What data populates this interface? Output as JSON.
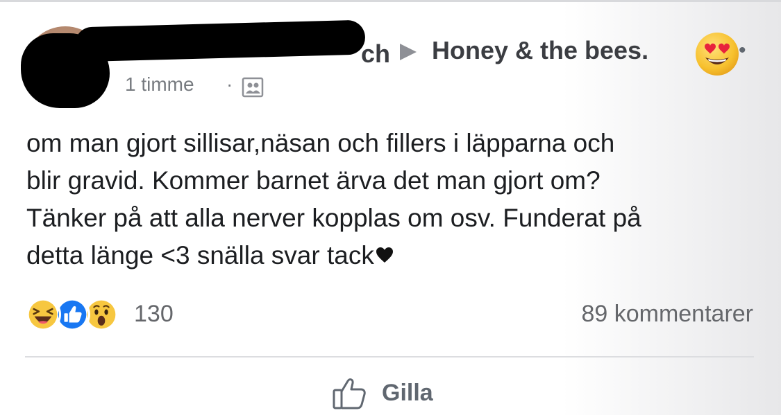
{
  "post": {
    "author_visible_tail": "ch",
    "group_name": "Honey & the bees.",
    "time": "1 timme",
    "separator": "·",
    "more_icon": "more-dots-icon",
    "audience_icon": "group-audience-icon",
    "body_lines": [
      "om man gjort sillisar,näsan och fillers i läpparna och",
      "blir gravid. Kommer barnet ärva det man gjort om?",
      "Tänker på att alla nerver kopplas om osv. Funderat på",
      "detta länge <3 snälla svar tack"
    ],
    "body_trailing_icon": "black-heart-icon"
  },
  "reactions": {
    "icons": [
      "laughing-emoji-icon",
      "like-thumb-icon",
      "wow-emoji-icon"
    ],
    "count": "130",
    "comments": "89 kommentarer"
  },
  "actions": {
    "like_label": "Gilla",
    "like_icon": "thumbs-up-outline-icon"
  },
  "colors": {
    "text": "#1c1e21",
    "meta": "#777b80",
    "like_blue": "#1877f2",
    "emoji_yellow": "#f7c740"
  }
}
